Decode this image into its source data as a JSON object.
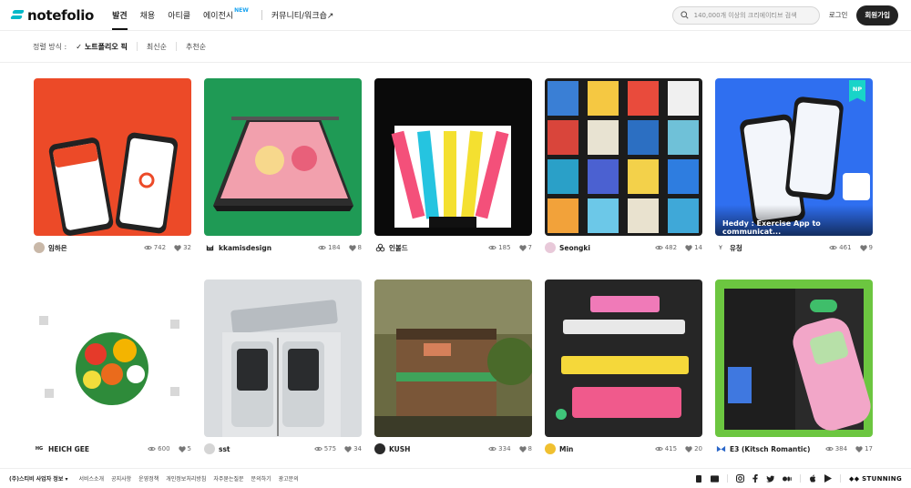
{
  "header": {
    "logo": "notefolio",
    "nav": [
      "발견",
      "채용",
      "아티클",
      "에이전시",
      "커뮤니티/워크숍↗"
    ],
    "nav_new_badge": "NEW",
    "search_placeholder": "140,000개 이상의 크리에이티브 검색",
    "login": "로그인",
    "signup": "회원가입"
  },
  "sort": {
    "label": "정렬 방식 :",
    "options": [
      "노트폴리오 픽",
      "최신순",
      "추천순"
    ]
  },
  "cards": [
    {
      "author": "임하은",
      "views": "742",
      "likes": "32",
      "avatar": "",
      "avatar_bg": "#c9b8a8"
    },
    {
      "author": "kkamisdesign",
      "views": "184",
      "likes": "8",
      "avatar": "",
      "avatar_bg": "#ffffff"
    },
    {
      "author": "인볼드",
      "views": "185",
      "likes": "7",
      "avatar": "",
      "avatar_bg": "#ffffff"
    },
    {
      "author": "Seongki",
      "views": "482",
      "likes": "14",
      "avatar": "",
      "avatar_bg": "#e8c9d9"
    },
    {
      "author": "유청",
      "views": "461",
      "likes": "9",
      "avatar": "Y",
      "avatar_bg": "#ffffff",
      "overlay": "Heddy : Exercise App to communicat...",
      "badge": "NP"
    },
    {
      "author": "HEICH GEE",
      "views": "600",
      "likes": "5",
      "avatar": "HG",
      "avatar_bg": "#ffffff"
    },
    {
      "author": "sst",
      "views": "575",
      "likes": "34",
      "avatar": "",
      "avatar_bg": "#d5d5d5"
    },
    {
      "author": "KUSH",
      "views": "334",
      "likes": "8",
      "avatar": "",
      "avatar_bg": "#2a2a2a"
    },
    {
      "author": "Min",
      "views": "415",
      "likes": "20",
      "avatar": "",
      "avatar_bg": "#f0c030"
    },
    {
      "author": "E3 (Kitsch Romantic)",
      "views": "384",
      "likes": "17",
      "avatar": "",
      "avatar_bg": "#ffffff"
    }
  ],
  "footer": {
    "company": "(주)스티비 사업자 정보",
    "links": [
      "서비스소개",
      "공지사항",
      "운영정책",
      "개인정보처리방침",
      "자주묻는질문",
      "문의하기",
      "광고문의"
    ],
    "brand": "STUNNING"
  }
}
